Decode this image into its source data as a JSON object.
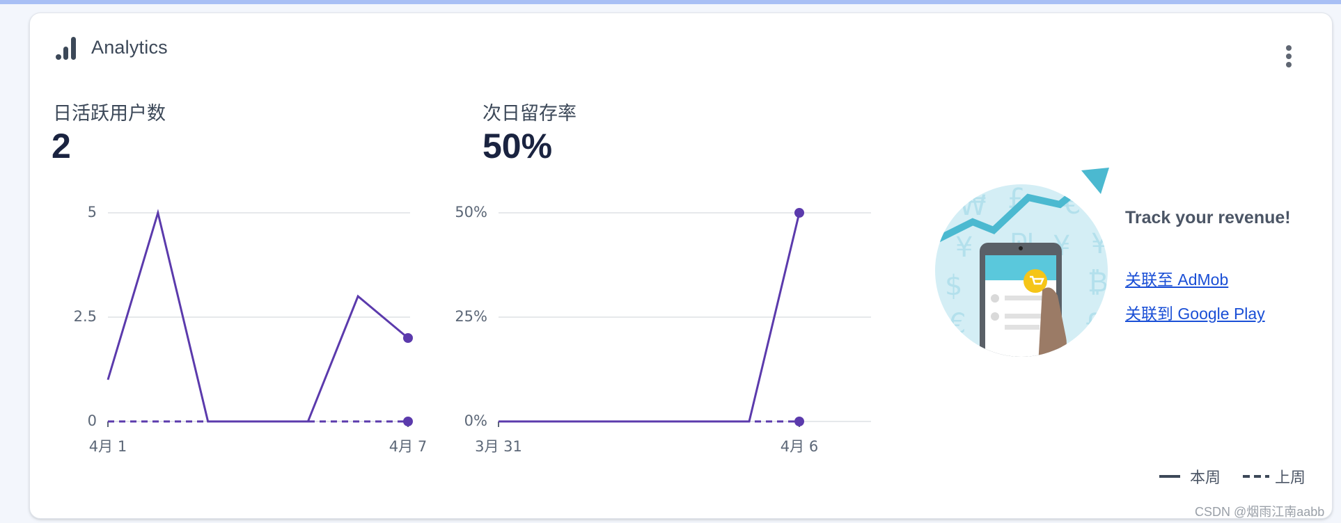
{
  "header": {
    "title": "Analytics",
    "icon": "bar-chart-icon",
    "menu_icon": "more-vert-icon"
  },
  "metrics": [
    {
      "label": "日活跃用户数",
      "value": "2"
    },
    {
      "label": "次日留存率",
      "value": "50%"
    }
  ],
  "chart_data": [
    {
      "type": "line",
      "title": "日活跃用户数",
      "x_tick_labels": [
        "4月 1",
        "4月 7"
      ],
      "y_tick_labels": [
        "5",
        "2.5",
        "0"
      ],
      "ylim": [
        0,
        5
      ],
      "grid": true,
      "series": [
        {
          "name": "本周",
          "style": "solid",
          "color": "#5b3aac",
          "values": [
            1,
            5,
            0,
            0,
            0,
            3,
            2
          ]
        },
        {
          "name": "上周",
          "style": "dashed",
          "color": "#5b3aac",
          "values": [
            0,
            0,
            0,
            0,
            0,
            0,
            0
          ]
        }
      ]
    },
    {
      "type": "line",
      "title": "次日留存率",
      "x_tick_labels": [
        "3月 31",
        "4月 6"
      ],
      "y_tick_labels": [
        "50%",
        "25%",
        "0%"
      ],
      "ylim": [
        0,
        50
      ],
      "grid": true,
      "series": [
        {
          "name": "本周",
          "style": "solid",
          "color": "#5b3aac",
          "values": [
            0,
            0,
            0,
            0,
            0,
            0,
            50
          ]
        },
        {
          "name": "上周",
          "style": "dashed",
          "color": "#5b3aac",
          "values": [
            0,
            0,
            0,
            0,
            0,
            0,
            0
          ]
        }
      ]
    }
  ],
  "promo": {
    "title": "Track your revenue!",
    "link_admob": "关联至 AdMob",
    "link_play": "关联到 Google Play",
    "illustration": "revenue-phone-illustration"
  },
  "legend": {
    "this_week": "本周",
    "last_week": "上周"
  },
  "watermark": "CSDN @烟雨江南aabb",
  "colors": {
    "accent": "#5b3aac",
    "link": "#1a4fd6",
    "title": "#3c4858"
  }
}
